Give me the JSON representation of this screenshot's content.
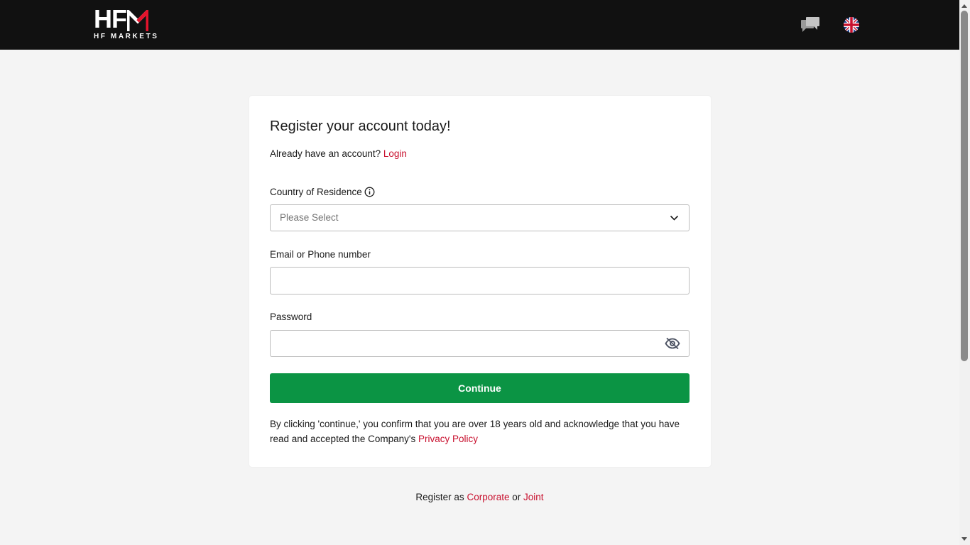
{
  "header": {
    "logo_text": "HFM",
    "logo_subtitle": "HF MARKETS",
    "chat_icon": "chat-bubbles-icon",
    "language_icon": "uk-flag-icon"
  },
  "form": {
    "title": "Register your account today!",
    "already_text": "Already have an account?",
    "login_link": "Login",
    "country_label": "Country of Residence",
    "country_placeholder": "Please Select",
    "email_label": "Email or Phone number",
    "email_value": "",
    "password_label": "Password",
    "password_value": "",
    "continue_label": "Continue",
    "consent_text": "By clicking 'continue,' you confirm that you are over 18 years old and acknowledge that you have read and accepted the Company's",
    "privacy_link": "Privacy Policy"
  },
  "footer": {
    "register_as": "Register as",
    "corporate_link": "Corporate",
    "or_text": "or",
    "joint_link": "Joint"
  },
  "colors": {
    "accent": "#c8102e",
    "button": "#0b9444",
    "header_bg": "#111111",
    "page_bg": "#f4f4f4"
  }
}
